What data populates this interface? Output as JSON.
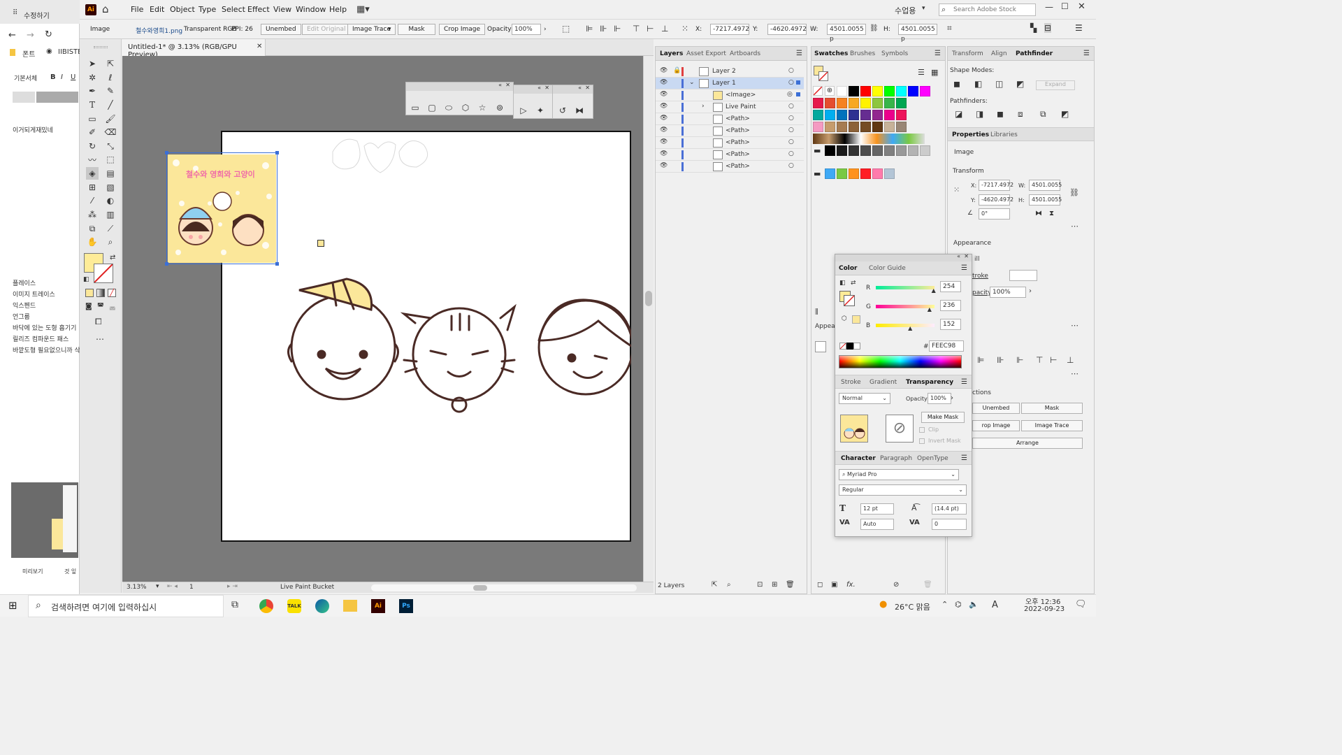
{
  "bgwin": {
    "tab": "수정하기",
    "bookmark1": "폰트",
    "bookmark2": "IIBISTE",
    "font_label": "기본서체",
    "body_text": "이거되게재밌네",
    "list": [
      "플레이스",
      "이미지 트레이스",
      "익스펜드",
      "언그룹",
      "바닥에 있는 도형 흡기기",
      "릴리즈 컴파운드 패스",
      "바깥도형 필요없으니까 삭"
    ],
    "preview": "미리보기",
    "bottom2": "것 잎"
  },
  "app": {
    "logo": "Ai",
    "menus": [
      "File",
      "Edit",
      "Object",
      "Type",
      "Select",
      "Effect",
      "View",
      "Window",
      "Help"
    ],
    "workspace": "수업용",
    "search_placeholder": "Search Adobe Stock"
  },
  "control": {
    "type_label": "Image",
    "filename": "철수와영희1.png",
    "color_mode": "Transparent RGB",
    "ppi": "PPI: 26",
    "embed_btn": "Unembed",
    "edit_original": "Edit Original",
    "image_trace": "Image Trace",
    "mask": "Mask",
    "crop": "Crop Image",
    "opacity_label": "Opacity:",
    "opacity": "100%",
    "x_label": "X:",
    "x": "-7217.4972",
    "y_label": "Y:",
    "y": "-4620.4972",
    "w_label": "W:",
    "w": "4501.0055 p",
    "h_label": "H:",
    "h": "4501.0055 p"
  },
  "document": {
    "tab_title": "Untitled-1* @ 3.13% (RGB/GPU Preview)",
    "zoom": "3.13%",
    "page": "1",
    "status_tool": "Live Paint Bucket"
  },
  "artwork": {
    "sticker_text": "철수와 영희와 고양이"
  },
  "layers": {
    "tabs": [
      "Layers",
      "Asset Export",
      "Artboards"
    ],
    "rows": [
      "Layer 2",
      "Layer 1",
      "<Image>",
      "Live Paint",
      "<Path>",
      "<Path>",
      "<Path>",
      "<Path>",
      "<Path>"
    ],
    "footer": "2 Layers"
  },
  "swatches": {
    "tabs": [
      "Swatches",
      "Brushes",
      "Symbols"
    ],
    "row1": [
      "#ffffff",
      "#000000",
      "#ff0000",
      "#ffff00",
      "#00ff00",
      "#00ffff",
      "#0000ff",
      "#ff00ff"
    ],
    "row2": [
      "#e6194b",
      "#e54d2e",
      "#f58220",
      "#f7a823",
      "#fff200",
      "#8dc63f",
      "#39b54a",
      "#00a651"
    ],
    "row3": [
      "#00a99d",
      "#00aeef",
      "#0072bc",
      "#2e3192",
      "#662d91",
      "#92278f",
      "#ec008c",
      "#ed145b"
    ],
    "row4": [
      "#f49ac2",
      "#c69c6d",
      "#a67c52",
      "#8c6239",
      "#754c24",
      "#603813",
      "#c7b299",
      "#998675"
    ],
    "grays": [
      "#000000",
      "#1a1a1a",
      "#333333",
      "#4d4d4d",
      "#666666",
      "#808080",
      "#999999",
      "#b3b3b3",
      "#cccccc"
    ],
    "extra": [
      "#3fa9f5",
      "#7ac943",
      "#ff931e",
      "#ff1d25",
      "#ff7bac",
      "#b3c5d6"
    ]
  },
  "rightpanel": {
    "tabs": [
      "Transform",
      "Align",
      "Pathfinder"
    ],
    "shape_modes": "Shape Modes:",
    "expand": "Expand",
    "pathfinders": "Pathfinders:",
    "props_tabs": [
      "Properties",
      "Libraries"
    ],
    "props_type": "Image",
    "transform": "Transform",
    "x_label": "X:",
    "x": "-7217.4972",
    "y_label": "Y:",
    "y": "-4620.4972",
    "w_label": "W:",
    "w": "4501.0055",
    "h_label": "H:",
    "h": "4501.0055",
    "angle": "0°",
    "appearance": "Appearance",
    "fill": "ill",
    "stroke": "troke",
    "opacity_label": "pacity",
    "opacity": "100%",
    "actions": "ctions",
    "unembed": "Unembed",
    "mask": "Mask",
    "crop": "rop Image",
    "trace": "Image Trace",
    "arrange": "Arrange"
  },
  "colorpanel": {
    "tabs": [
      "Color",
      "Color Guide"
    ],
    "r_label": "R",
    "g_label": "G",
    "b_label": "B",
    "r": "254",
    "g": "236",
    "b": "152",
    "r_frac": 0.996,
    "g_frac": 0.925,
    "b_frac": 0.596,
    "hex_label": "#",
    "hex": "FEEC98",
    "fill": "#feec98"
  },
  "transparency": {
    "tabs": [
      "Stroke",
      "Gradient",
      "Transparency"
    ],
    "mode": "Normal",
    "opacity_label": "Opacity:",
    "opacity": "100%",
    "make_mask": "Make Mask",
    "clip": "Clip",
    "invert": "Invert Mask"
  },
  "character": {
    "tabs": [
      "Character",
      "Paragraph",
      "OpenType"
    ],
    "font": "Myriad Pro",
    "style": "Regular",
    "size": "12 pt",
    "leading": "(14.4 pt)",
    "tracking_mode": "Auto",
    "tracking": "0"
  },
  "appearance_float": {
    "label": "Appea"
  },
  "taskbar": {
    "search": "검색하려면 여기에 입력하십시",
    "weather": "26°C 맑음",
    "time": "오후 12:36",
    "date": "2022-09-23",
    "lang": "A"
  }
}
